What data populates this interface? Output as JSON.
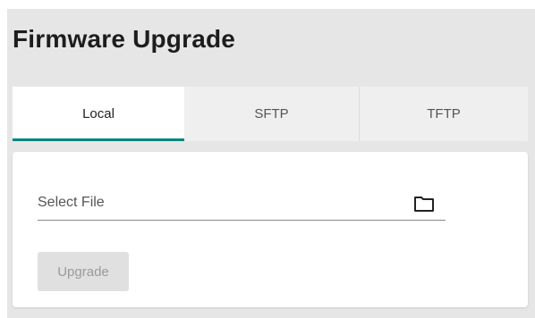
{
  "page": {
    "title": "Firmware Upgrade"
  },
  "tabs": [
    {
      "label": "Local",
      "active": true
    },
    {
      "label": "SFTP",
      "active": false
    },
    {
      "label": "TFTP",
      "active": false
    }
  ],
  "form": {
    "file_placeholder": "Select File",
    "file_icon": "folder-icon",
    "upgrade_label": "Upgrade",
    "upgrade_disabled": true
  },
  "colors": {
    "accent": "#00857c",
    "panel_bg": "#e6e6e6"
  }
}
